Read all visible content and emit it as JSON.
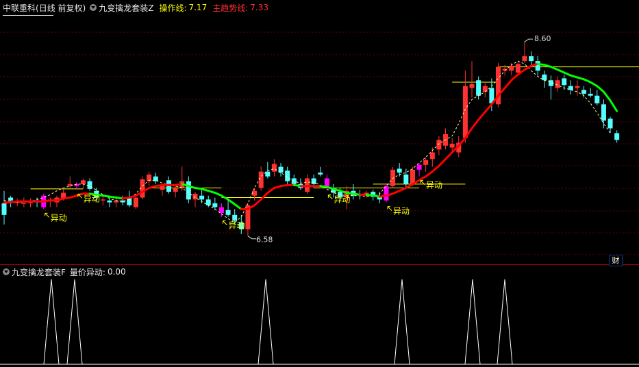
{
  "main_header": {
    "stock_name": "中联重科",
    "period": "(日线 前复权)",
    "indicator": "九变擒龙套装Z",
    "op_line_label": "操作线:",
    "op_line_value": "7.17",
    "trend_line_label": "主趋势线:",
    "trend_line_value": "7.33"
  },
  "sub_header": {
    "indicator": "九变擒龙套装F",
    "label": "量价异动:",
    "value": "0.00"
  },
  "badge": "财",
  "colors": {
    "up": "#ff3232",
    "down": "#54ffff",
    "signal": "#ff00ff",
    "trend_up": "#ff0000",
    "trend_down": "#00ff00",
    "op_line": "#ffff00",
    "label": "#ffff00",
    "grid": "#6b0000"
  },
  "chart_data": [
    {
      "type": "candlestick",
      "title": "",
      "ylim": [
        6.4,
        8.75
      ],
      "high_label": "8.60",
      "low_label": "6.58",
      "annotation_text": "异动",
      "annotations": [
        6,
        11,
        33,
        49,
        58,
        63
      ],
      "series": [
        {
          "name": "candles",
          "o_h_l_c": [
            [
              6.92,
              7.05,
              6.7,
              6.8
            ],
            [
              6.98,
              7.0,
              6.88,
              6.95
            ],
            [
              6.93,
              6.97,
              6.89,
              6.93
            ],
            [
              6.92,
              6.98,
              6.88,
              6.92
            ],
            [
              6.93,
              6.97,
              6.88,
              6.93
            ],
            [
              6.95,
              6.98,
              6.88,
              6.93
            ],
            [
              6.88,
              7.02,
              6.86,
              7.0
            ],
            [
              6.95,
              6.98,
              6.88,
              6.96
            ],
            [
              6.93,
              7.0,
              6.88,
              6.98
            ],
            [
              6.97,
              7.08,
              6.95,
              7.03
            ],
            [
              7.1,
              7.2,
              7.08,
              7.12
            ],
            [
              7.1,
              7.14,
              7.06,
              7.12
            ],
            [
              7.12,
              7.18,
              7.08,
              7.16
            ],
            [
              7.15,
              7.18,
              7.05,
              7.07
            ],
            [
              7.05,
              7.08,
              6.95,
              6.98
            ],
            [
              6.95,
              7.02,
              6.9,
              6.96
            ],
            [
              6.95,
              7.0,
              6.88,
              6.93
            ],
            [
              6.93,
              7.0,
              6.88,
              6.95
            ],
            [
              6.95,
              7.0,
              6.9,
              6.93
            ],
            [
              6.98,
              7.05,
              6.88,
              6.9
            ],
            [
              6.88,
              7.02,
              6.86,
              6.98
            ],
            [
              6.98,
              7.2,
              6.96,
              7.17
            ],
            [
              7.15,
              7.25,
              7.1,
              7.22
            ],
            [
              7.2,
              7.24,
              7.12,
              7.15
            ],
            [
              7.06,
              7.12,
              7.0,
              7.1
            ],
            [
              7.16,
              7.2,
              7.02,
              7.04
            ],
            [
              7.04,
              7.1,
              6.98,
              7.08
            ],
            [
              7.08,
              7.3,
              7.05,
              7.15
            ],
            [
              7.15,
              7.2,
              6.92,
              6.96
            ],
            [
              6.96,
              7.04,
              6.88,
              7.02
            ],
            [
              7.0,
              7.06,
              6.92,
              6.96
            ],
            [
              6.96,
              7.0,
              6.88,
              6.9
            ],
            [
              6.92,
              6.98,
              6.85,
              6.88
            ],
            [
              6.88,
              6.92,
              6.78,
              6.82
            ],
            [
              6.85,
              6.95,
              6.78,
              6.8
            ],
            [
              6.8,
              6.86,
              6.7,
              6.74
            ],
            [
              6.72,
              6.8,
              6.6,
              6.65
            ],
            [
              6.65,
              6.92,
              6.58,
              6.9
            ],
            [
              7.0,
              7.08,
              6.95,
              7.05
            ],
            [
              7.08,
              7.3,
              7.05,
              7.25
            ],
            [
              7.25,
              7.35,
              7.18,
              7.2
            ],
            [
              7.25,
              7.38,
              7.2,
              7.33
            ],
            [
              7.3,
              7.34,
              7.2,
              7.24
            ],
            [
              7.26,
              7.3,
              7.12,
              7.15
            ],
            [
              7.18,
              7.22,
              7.1,
              7.12
            ],
            [
              7.12,
              7.18,
              7.06,
              7.08
            ],
            [
              7.04,
              7.22,
              7.02,
              7.18
            ],
            [
              7.18,
              7.22,
              7.08,
              7.12
            ],
            [
              7.24,
              7.3,
              7.2,
              7.22
            ],
            [
              7.18,
              7.22,
              7.05,
              7.08
            ],
            [
              7.08,
              7.12,
              6.98,
              7.03
            ],
            [
              7.04,
              7.08,
              6.95,
              6.98
            ],
            [
              6.98,
              7.1,
              6.86,
              7.05
            ],
            [
              7.05,
              7.12,
              6.96,
              7.0
            ],
            [
              7.02,
              7.06,
              6.96,
              7.01
            ],
            [
              7.0,
              7.05,
              6.98,
              7.03
            ],
            [
              7.04,
              7.06,
              6.95,
              7.0
            ],
            [
              7.0,
              7.04,
              6.92,
              6.96
            ],
            [
              6.95,
              7.12,
              6.93,
              7.1
            ],
            [
              7.1,
              7.3,
              7.08,
              7.27
            ],
            [
              7.28,
              7.34,
              7.2,
              7.24
            ],
            [
              7.22,
              7.28,
              7.08,
              7.12
            ],
            [
              7.12,
              7.3,
              7.1,
              7.27
            ],
            [
              7.27,
              7.34,
              7.2,
              7.32
            ],
            [
              7.32,
              7.4,
              7.25,
              7.37
            ],
            [
              7.38,
              7.5,
              7.3,
              7.45
            ],
            [
              7.48,
              7.62,
              7.42,
              7.58
            ],
            [
              7.52,
              7.7,
              7.48,
              7.64
            ],
            [
              7.5,
              7.6,
              7.45,
              7.54
            ],
            [
              7.45,
              7.62,
              7.4,
              7.55
            ],
            [
              7.6,
              8.3,
              7.55,
              8.14
            ],
            [
              8.12,
              8.4,
              8.02,
              8.16
            ],
            [
              8.2,
              8.24,
              8.0,
              8.04
            ],
            [
              8.08,
              8.18,
              8.02,
              8.14
            ],
            [
              8.12,
              8.22,
              7.88,
              7.96
            ],
            [
              7.95,
              8.38,
              7.92,
              8.34
            ],
            [
              8.3,
              8.36,
              8.25,
              8.32
            ],
            [
              8.3,
              8.38,
              8.25,
              8.35
            ],
            [
              8.28,
              8.4,
              8.25,
              8.37
            ],
            [
              8.4,
              8.6,
              8.38,
              8.45
            ],
            [
              8.45,
              8.5,
              8.35,
              8.4
            ],
            [
              8.4,
              8.45,
              8.25,
              8.3
            ],
            [
              8.26,
              8.3,
              8.12,
              8.2
            ],
            [
              8.2,
              8.25,
              8.0,
              8.14
            ],
            [
              8.12,
              8.24,
              8.08,
              8.2
            ],
            [
              8.22,
              8.26,
              8.1,
              8.15
            ],
            [
              8.14,
              8.2,
              8.05,
              8.1
            ],
            [
              8.12,
              8.2,
              8.04,
              8.14
            ],
            [
              8.1,
              8.14,
              8.02,
              8.06
            ],
            [
              8.06,
              8.12,
              8.02,
              8.04
            ],
            [
              8.04,
              8.1,
              7.94,
              7.96
            ],
            [
              7.95,
              8.0,
              7.7,
              7.78
            ],
            [
              7.8,
              7.82,
              7.65,
              7.7
            ],
            [
              7.65,
              7.68,
              7.55,
              7.58
            ]
          ]
        },
        {
          "name": "",
          "values_trend": [
            6.93,
            6.93,
            6.94,
            6.94,
            6.94,
            6.94,
            6.94,
            6.95,
            6.95,
            6.97,
            6.98,
            7.0,
            7.02,
            7.02,
            7.01,
            7.0,
            6.99,
            6.98,
            6.97,
            6.98,
            7.0,
            7.04,
            7.08,
            7.1,
            7.11,
            7.11,
            7.11,
            7.12,
            7.1,
            7.08,
            7.07,
            7.05,
            7.03,
            7.0,
            6.96,
            6.91,
            6.86,
            6.86,
            6.9,
            6.96,
            7.03,
            7.08,
            7.1,
            7.11,
            7.11,
            7.1,
            7.1,
            7.1,
            7.1,
            7.09,
            7.07,
            7.05,
            7.03,
            7.02,
            7.01,
            7.01,
            7.0,
            6.99,
            7.0,
            7.02,
            7.05,
            7.08,
            7.12,
            7.16,
            7.2,
            7.25,
            7.31,
            7.38,
            7.45,
            7.52,
            7.6,
            7.7,
            7.79,
            7.87,
            7.95,
            8.04,
            8.12,
            8.2,
            8.26,
            8.31,
            8.35,
            8.37,
            8.36,
            8.34,
            8.31,
            8.28,
            8.25,
            8.23,
            8.21,
            8.18,
            8.14,
            8.08,
            7.99,
            7.88
          ]
        },
        {
          "name": "",
          "values_ma": [
            6.95,
            6.94,
            6.93,
            6.93,
            6.94,
            6.96,
            6.98,
            7.01,
            7.05,
            7.08,
            7.1,
            7.12,
            7.12,
            7.1,
            7.06,
            7.01,
            6.97,
            6.95,
            6.94,
            6.96,
            7.02,
            7.1,
            7.16,
            7.16,
            7.13,
            7.11,
            7.1,
            7.08,
            7.03,
            6.98,
            6.94,
            6.9,
            6.86,
            6.81,
            6.76,
            6.72,
            6.78,
            6.92,
            7.08,
            7.2,
            7.26,
            7.28,
            7.24,
            7.19,
            7.15,
            7.13,
            7.14,
            7.14,
            7.11,
            7.07,
            7.03,
            7.01,
            7.0,
            7.0,
            7.0,
            6.99,
            6.99,
            7.02,
            7.1,
            7.18,
            7.22,
            7.24,
            7.28,
            7.34,
            7.4,
            7.47,
            7.54,
            7.58,
            7.62,
            7.75,
            7.9,
            8.0,
            8.04,
            8.08,
            8.14,
            8.22,
            8.3,
            8.36,
            8.4,
            8.37,
            8.3,
            8.24,
            8.2,
            8.18,
            8.15,
            8.12,
            8.1,
            8.08,
            8.04,
            7.96,
            7.86,
            7.75,
            7.65
          ]
        },
        {
          "name": "",
          "segments": [
            [
              4,
              12,
              7.07
            ],
            [
              22,
              33,
              7.08
            ],
            [
              33,
              47,
              6.98
            ],
            [
              47,
              63,
              7.08
            ],
            [
              56,
              70,
              7.12
            ],
            [
              68,
              75,
              8.18
            ],
            [
              75,
              97,
              8.34
            ]
          ]
        }
      ]
    },
    {
      "type": "spike",
      "ylim": [
        0,
        1
      ],
      "x": [
        11,
        15,
        40,
        61,
        72,
        77
      ],
      "values": [
        1,
        1,
        1,
        1,
        1,
        1
      ]
    }
  ]
}
